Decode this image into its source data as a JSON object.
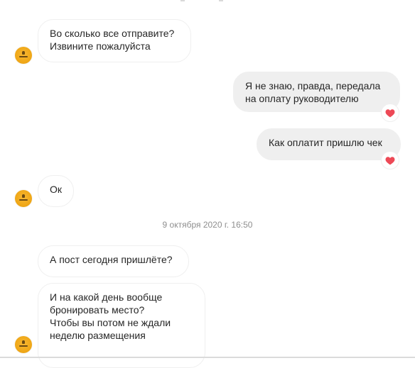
{
  "conversation": {
    "messages": [
      {
        "side": "incoming",
        "text": "Во сколько все отправите?\nИзвините пожалуйста"
      },
      {
        "side": "outgoing",
        "text": "Я не знаю, правда, передала\nна оплату руководителю",
        "reaction": "heart-icon"
      },
      {
        "side": "outgoing",
        "text": "Как оплатит пришлю чек",
        "reaction": "heart-icon"
      },
      {
        "side": "incoming",
        "text": "Ок"
      },
      {
        "side": "timestamp",
        "text": "9 октября 2020 г. 16:50"
      },
      {
        "side": "incoming",
        "text": "А пост сегодня пришлёте?"
      },
      {
        "side": "incoming",
        "text": "И на какой день вообще\nбронировать место?\nЧтобы вы потом не ждали\nнеделю размещения"
      }
    ]
  },
  "colors": {
    "outgoing_bubble": "#efefef",
    "incoming_border": "#efefef",
    "timestamp_text": "#8e8e8e",
    "avatar": "#f0a818",
    "heart": "#ed4956"
  }
}
